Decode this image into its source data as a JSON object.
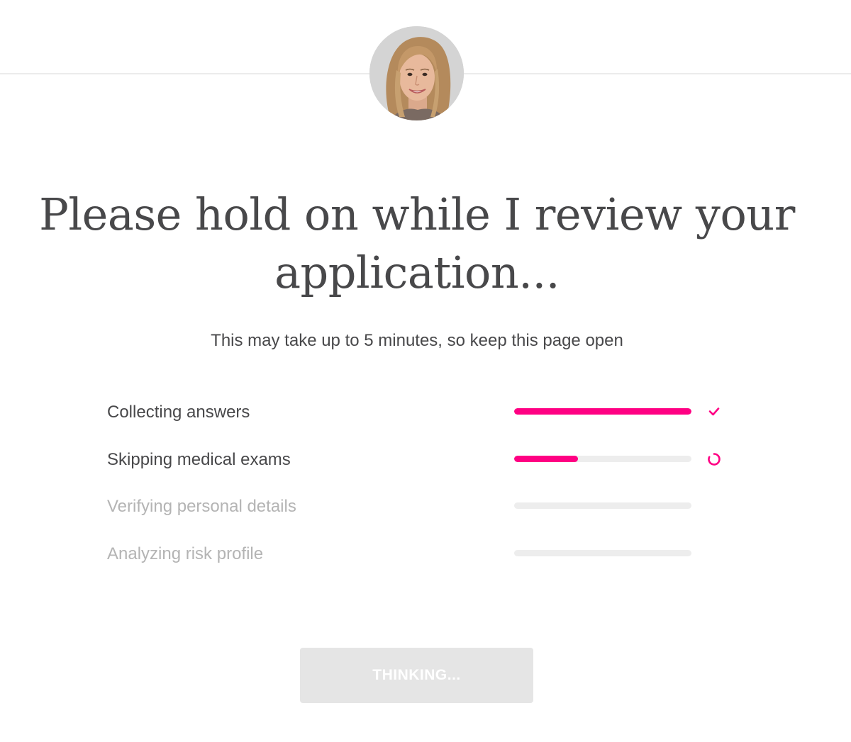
{
  "header": {
    "avatar_icon": "agent-portrait"
  },
  "main": {
    "title_line1": "Please hold on while I review your",
    "title_line2": "application...",
    "subtitle": "This may take up to 5 minutes, so keep this page open"
  },
  "steps": [
    {
      "label": "Collecting answers",
      "progress": 1.0,
      "state": "done",
      "status_icon": "check-icon"
    },
    {
      "label": "Skipping medical exams",
      "progress": 0.36,
      "state": "in-progress",
      "status_icon": "spinner-icon"
    },
    {
      "label": "Verifying personal details",
      "progress": 0.0,
      "state": "pending",
      "status_icon": ""
    },
    {
      "label": "Analyzing risk profile",
      "progress": 0.0,
      "state": "pending",
      "status_icon": ""
    }
  ],
  "button": {
    "label": "THINKING..."
  },
  "colors": {
    "accent": "#ff0083",
    "track": "#ededed",
    "text": "#48484a",
    "muted_text": "#b4b4b4",
    "button_bg": "#e5e5e5"
  }
}
